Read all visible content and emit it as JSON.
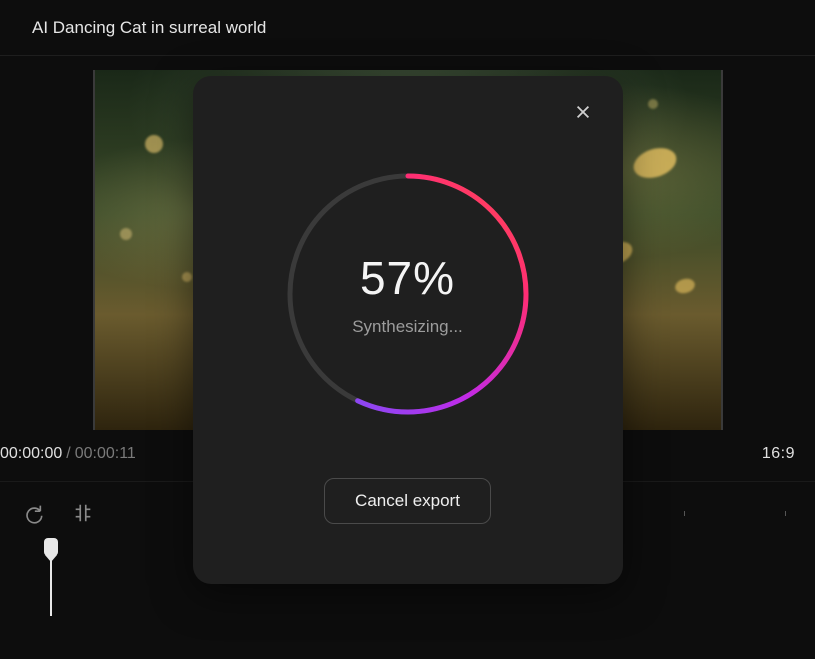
{
  "header": {
    "title": "AI Dancing Cat in surreal world"
  },
  "time": {
    "current": "00:00:00",
    "total": "00:00:11",
    "separator": "/"
  },
  "aspect_ratio": "16:9",
  "toolbar": {
    "redo": "redo",
    "split": "split"
  },
  "export_modal": {
    "progress_percent": 57,
    "progress_label": "57%",
    "status_text": "Synthesizing...",
    "cancel_label": "Cancel export",
    "close_label": "Close",
    "ring": {
      "radius": 118,
      "circumference": 741.4,
      "track_color": "#3a3a3a",
      "gradient_stops": [
        "#6a5af9",
        "#c02ae8",
        "#ff2d74",
        "#ff4d4d"
      ]
    }
  }
}
